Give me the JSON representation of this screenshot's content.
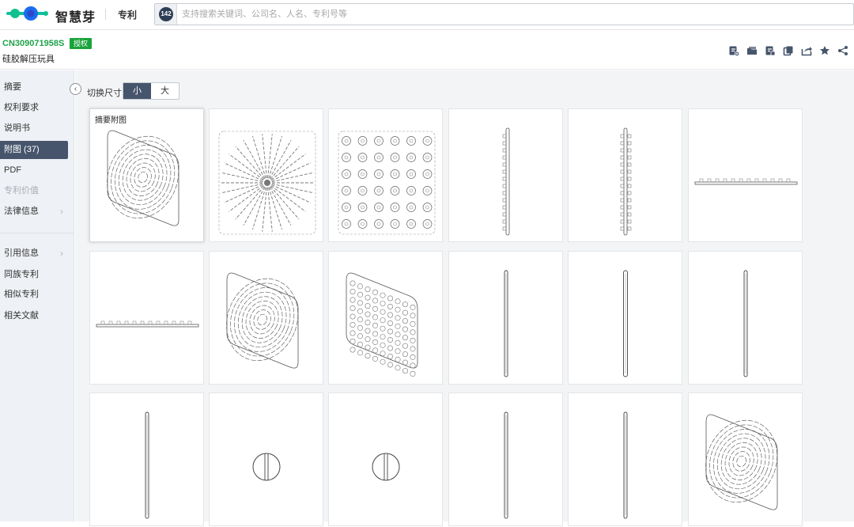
{
  "header": {
    "brand": "智慧芽",
    "product": "专利",
    "search_badge": "142",
    "search_placeholder": "支持搜索关键词、公司名、人名、专利号等"
  },
  "patent": {
    "id": "CN309071958S",
    "status": "授权",
    "title": "硅胶解压玩具"
  },
  "toolbar_icons": [
    "add-note-icon",
    "folder-icon",
    "export-icon",
    "copy-icon",
    "share-box-icon",
    "star-icon",
    "share-icon"
  ],
  "sidebar": {
    "items": [
      {
        "label": "摘要"
      },
      {
        "label": "权利要求"
      },
      {
        "label": "说明书"
      },
      {
        "label": "附图 (37)"
      },
      {
        "label": "PDF"
      },
      {
        "label": "专利价值"
      },
      {
        "label": "法律信息"
      },
      {
        "label": "引用信息"
      },
      {
        "label": "同族专利"
      },
      {
        "label": "相似专利"
      },
      {
        "label": "相关文献"
      }
    ],
    "active": "附图 (37)"
  },
  "main": {
    "size_label": "切换尺寸",
    "size_options": [
      "小",
      "大"
    ],
    "selected_size": "小",
    "first_card_label": "摘要附图",
    "figures": [
      "isometric-swirl",
      "top-radial",
      "top-flower",
      "side-thin-bumps",
      "side-bumps",
      "front-flat",
      "front-flat-2",
      "isometric-swirl-2",
      "isometric-flower",
      "side-rod",
      "side-rod-2",
      "side-rod-3",
      "side-rod-4",
      "circle-end",
      "circle-end-2",
      "side-rod-5",
      "side-rod-6",
      "isometric-swirl-3"
    ]
  }
}
